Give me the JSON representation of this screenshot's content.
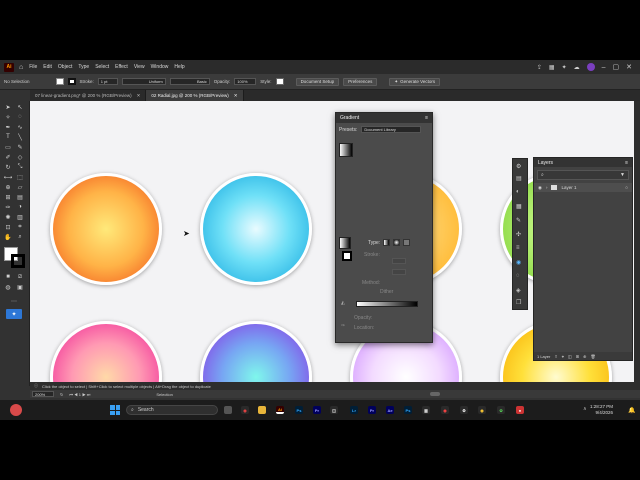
{
  "menubar": {
    "app_logo": "Ai",
    "items": [
      "File",
      "Edit",
      "Object",
      "Type",
      "Select",
      "Effect",
      "View",
      "Window",
      "Help"
    ],
    "generate_vectors": "Generate Vectors"
  },
  "control_bar": {
    "selection": "No Selection",
    "stroke_label": "Stroke:",
    "stroke_value": "1 pt",
    "profile": "Uniform",
    "brush": "Basic",
    "opacity_label": "Opacity:",
    "opacity_value": "100%",
    "style_label": "Style:",
    "document_setup": "Document Setup",
    "preferences": "Preferences"
  },
  "tabs": [
    {
      "label": "07 linear-gradient.png* @ 200 % (RGB/Preview)",
      "active": false
    },
    {
      "label": "02 Radial.jpg @ 200 % (RGB/Preview)",
      "active": true
    }
  ],
  "gradient_panel": {
    "title": "Gradient",
    "presets_label": "Presets:",
    "presets_value": "Document Library",
    "type_label": "Type:",
    "stroke_label": "Stroke:",
    "method": "Method:",
    "dither": "Dither",
    "opacity_label": "Opacity:",
    "location_label": "Location:"
  },
  "layers_panel": {
    "title": "Layers",
    "layer_name": "Layer 1",
    "count": "1 Layer"
  },
  "status": {
    "hint": "Click the object to select | Shift+Click to select multiple objects | Alt+Drag the object to duplicate",
    "zoom": "200%",
    "mode": "Selection"
  },
  "taskbar": {
    "search_placeholder": "Search",
    "time": "1:28:27 PM",
    "date": "9/4/2026"
  },
  "colors": {
    "accent": "#2d77d6",
    "canvas": "#f3f3f5"
  }
}
